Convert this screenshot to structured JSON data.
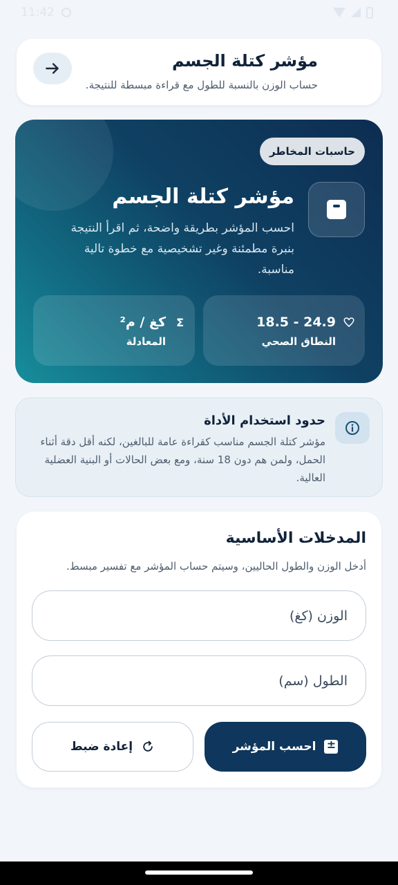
{
  "status_bar": {
    "time": "11:42"
  },
  "header": {
    "title": "مؤشر كتلة الجسم",
    "subtitle": "حساب الوزن بالنسبة للطول مع قراءة مبسطة للنتيجة.",
    "back_icon": "arrow-right-icon"
  },
  "hero": {
    "badge": "حاسبات المخاطر",
    "title": "مؤشر كتلة الجسم",
    "description": "احسب المؤشر بطريقة واضحة، ثم اقرأ النتيجة بنبرة مطمئنة وغير تشخيصية مع خطوة تالية مناسبة.",
    "icon": "scale-icon",
    "range": {
      "value": "18.5 - 24.9",
      "label": "النطاق الصحي",
      "icon": "heart-icon"
    },
    "formula": {
      "value": "كغ / م²",
      "label": "المعادلة",
      "icon": "sigma-icon"
    }
  },
  "info": {
    "title": "حدود استخدام الأداة",
    "description": "مؤشر كتلة الجسم مناسب كقراءة عامة للبالغين، لكنه أقل دقة أثناء الحمل، ولمن هم دون 18 سنة، ومع بعض الحالات أو البنية العضلية العالية.",
    "icon": "info-icon"
  },
  "inputs": {
    "title": "المدخلات الأساسية",
    "subtitle": "أدخل الوزن والطول الحاليين، وسيتم حساب المؤشر مع تفسير مبسط.",
    "weight_placeholder": "الوزن (كغ)",
    "height_placeholder": "الطول (سم)",
    "calculate_label": "احسب المؤشر",
    "reset_label": "إعادة ضبط"
  },
  "colors": {
    "primary": "#0f365c",
    "hero_start": "#0d2d52",
    "hero_end": "#178e9b",
    "background": "#f2f6fa"
  }
}
